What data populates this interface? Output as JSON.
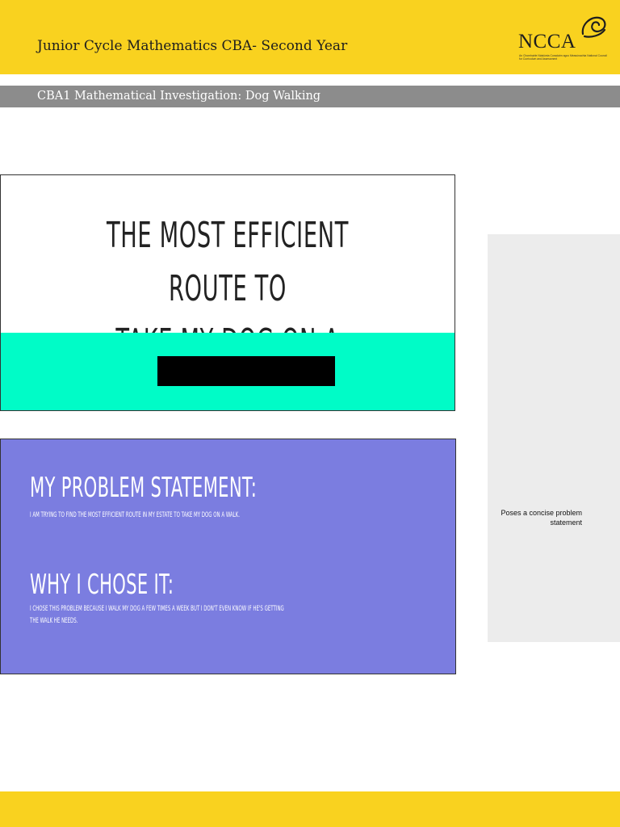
{
  "header": {
    "title": "Junior Cycle Mathematics CBA- Second Year",
    "logo_text": "NCCA",
    "logo_subtitle": "An Chomhairle Náisiúnta Curaclaim agus Measúnachta National Council for Curriculum and Assessment",
    "band_color": "#f9d21f"
  },
  "subheader": {
    "title": "CBA1 Mathematical Investigation: Dog Walking",
    "band_color": "#8c8c8c"
  },
  "slide1": {
    "title_line1": "The most efficient route to",
    "title_line2": "take my dog on a walk",
    "band_color": "#00fcc7"
  },
  "slide2": {
    "heading1": "My problem statement:",
    "body1": "I am trying to find the most efficient route in my estate to take my dog on a walk.",
    "heading2": "Why I chose it:",
    "body2": "I chose this problem because I walk my dog a few times a week but I don't even know if he's getting the walk he needs.",
    "background_color": "#7b7de0"
  },
  "side_panel": {
    "note": "Poses a concise problem statement"
  },
  "icons": {
    "logo_swirl": "spiral-swirl-icon"
  }
}
